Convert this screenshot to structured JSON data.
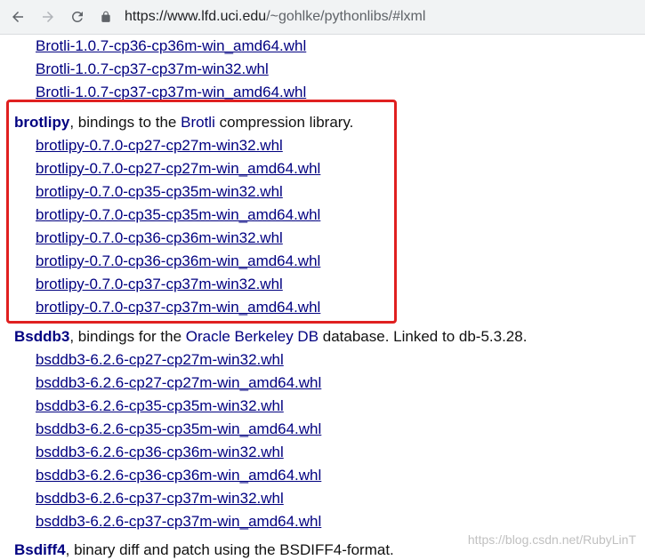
{
  "browser": {
    "url_host": "https://www.lfd.uci.edu",
    "url_path": "/~gohlke/pythonlibs/#lxml"
  },
  "top_files": [
    "Brotli-1.0.7-cp36-cp36m-win_amd64.whl",
    "Brotli-1.0.7-cp37-cp37m-win32.whl",
    "Brotli-1.0.7-cp37-cp37m-win_amd64.whl"
  ],
  "brotlipy": {
    "name": "brotlipy",
    "desc_1": ", bindings to the ",
    "link": "Brotli",
    "desc_2": " compression library.",
    "files": [
      "brotlipy-0.7.0-cp27-cp27m-win32.whl",
      "brotlipy-0.7.0-cp27-cp27m-win_amd64.whl",
      "brotlipy-0.7.0-cp35-cp35m-win32.whl",
      "brotlipy-0.7.0-cp35-cp35m-win_amd64.whl",
      "brotlipy-0.7.0-cp36-cp36m-win32.whl",
      "brotlipy-0.7.0-cp36-cp36m-win_amd64.whl",
      "brotlipy-0.7.0-cp37-cp37m-win32.whl",
      "brotlipy-0.7.0-cp37-cp37m-win_amd64.whl"
    ]
  },
  "bsddb3": {
    "name": "Bsddb3",
    "desc_1": ", bindings for the ",
    "link": "Oracle Berkeley DB",
    "desc_2": " database. Linked to db-5.3.28.",
    "files": [
      "bsddb3-6.2.6-cp27-cp27m-win32.whl",
      "bsddb3-6.2.6-cp27-cp27m-win_amd64.whl",
      "bsddb3-6.2.6-cp35-cp35m-win32.whl",
      "bsddb3-6.2.6-cp35-cp35m-win_amd64.whl",
      "bsddb3-6.2.6-cp36-cp36m-win32.whl",
      "bsddb3-6.2.6-cp36-cp36m-win_amd64.whl",
      "bsddb3-6.2.6-cp37-cp37m-win32.whl",
      "bsddb3-6.2.6-cp37-cp37m-win_amd64.whl"
    ]
  },
  "bsdiff4": {
    "name": "Bsdiff4",
    "desc": ", binary diff and patch using the BSDIFF4-format."
  },
  "watermark": "https://blog.csdn.net/RubyLinT",
  "colors": {
    "link": "#000080",
    "highlight_border": "#e02020",
    "toolbar_bg": "#f1f3f4"
  }
}
